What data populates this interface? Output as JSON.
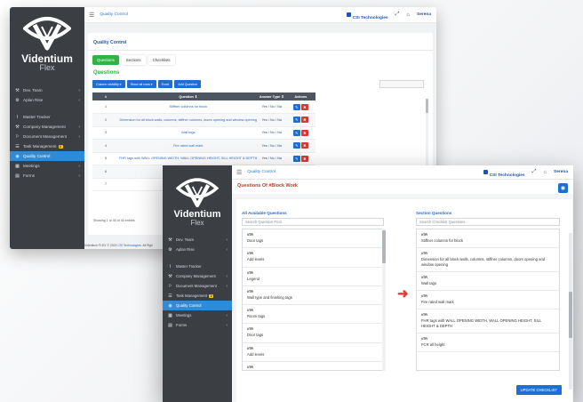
{
  "brand": {
    "name": "Videntium",
    "sub": "Flex"
  },
  "topbar": {
    "breadcrumb": "Quality Control",
    "company": "CSI Technologies",
    "user": "Serena"
  },
  "sidebar": [
    {
      "icon": "⚒",
      "icon_name": "team-tools-icon",
      "label": "Dev. Team",
      "chev": true
    },
    {
      "icon": "⚙",
      "icon_name": "settings-icon",
      "label": "Aplan Rise",
      "chev": true
    },
    {
      "icon": "⌇",
      "icon_name": "chart-icon",
      "label": "Master Tracker",
      "chev": false
    },
    {
      "icon": "⚒",
      "icon_name": "hammer-icon",
      "label": "Company Management",
      "chev": true
    },
    {
      "icon": "⚐",
      "icon_name": "sitemap-icon",
      "label": "Document Management",
      "chev": true
    },
    {
      "icon": "☰",
      "icon_name": "tasks-icon",
      "label": "Task Management",
      "badge": "2",
      "chev": false
    },
    {
      "icon": "◉",
      "icon_name": "quality-control-icon",
      "label": "Quality Control",
      "active": true,
      "chev": false
    },
    {
      "icon": "▦",
      "icon_name": "meetings-icon",
      "label": "Meetings",
      "chev": true
    },
    {
      "icon": "▤",
      "icon_name": "forms-icon",
      "label": "Forms",
      "chev": true
    }
  ],
  "qc": {
    "title": "Quality Control",
    "tabs": [
      "Questions",
      "Sections",
      "Checklists"
    ],
    "section_heading": "Questions",
    "toolbar": [
      "Column visibility ▾",
      "Show all rows ▾",
      "Excel",
      "Add Question"
    ],
    "columns": [
      "#",
      "Question",
      "Answer Type",
      "Actions"
    ],
    "sort_icon": "⇕",
    "rows": [
      {
        "n": "1",
        "q": "Stiffner columns for block",
        "a": "Yes / No / Na"
      },
      {
        "n": "2",
        "q": "Dimension for all block walls, columns, stiffner columns, doors opening and window opening",
        "a": "Yes / No / Na"
      },
      {
        "n": "3",
        "q": "Wall tags",
        "a": "Yes / No / Na"
      },
      {
        "n": "4",
        "q": "Fire rated wall mark",
        "a": "Yes / No / Na"
      },
      {
        "n": "5",
        "q": "FHR tags with WALL OPENING WIDTH, WALL OPENING HEIGHT, SILL HEIGHT & DEPTH",
        "a": "Yes / No / Na"
      },
      {
        "n": "6",
        "q": "",
        "a": ""
      },
      {
        "n": "7",
        "q": "",
        "a": ""
      }
    ],
    "showing": "Showing 1 to 40 of 40 entries",
    "footer_prefix": "Videntium FLEX © 2023",
    "footer_link": "CSI Technologies",
    "footer_suffix": ". All Righ"
  },
  "qow": {
    "title": "Questions Of #Block Work",
    "left_title": "All Available Questions",
    "left_placeholder": "Search Question Pool",
    "right_title": "Section Questions",
    "right_placeholder": "Search Checklist Questions",
    "available": [
      {
        "id": "#TR",
        "text": "Door tags"
      },
      {
        "id": "#TR",
        "text": "Add levels"
      },
      {
        "id": "#TR",
        "text": "Legend"
      },
      {
        "id": "#TR",
        "text": "Wall type and finishing tags"
      },
      {
        "id": "#TR",
        "text": "Room tags"
      },
      {
        "id": "#TR",
        "text": "Door tags"
      },
      {
        "id": "#TR",
        "text": "Add levels"
      },
      {
        "id": "#TR",
        "text": "Dimension"
      },
      {
        "id": "#TR",
        "text": ""
      }
    ],
    "section": [
      {
        "id": "#TR",
        "text": "Stiffner columns for block"
      },
      {
        "id": "#TR",
        "text": "Dimension for all block walls, columns, stiffner columns, doors opening and window opening"
      },
      {
        "id": "#TR",
        "text": "Wall tags"
      },
      {
        "id": "#TR",
        "text": "Fire rated wall mark"
      },
      {
        "id": "#TR",
        "text": "FHR tags with WALL OPENING WIDTH, WALL OPENING HEIGHT, SILL HEIGHT & DEPTH"
      },
      {
        "id": "#TR",
        "text": "FCR all height"
      }
    ],
    "update_label": "UPDATE CHECKLIST"
  },
  "colors": {
    "sidebar": "#3b3f44",
    "active": "#2e8bd8",
    "green": "#2fb344",
    "blue": "#1d6fd1",
    "red": "#d63939",
    "title_red": "#c0392b"
  }
}
